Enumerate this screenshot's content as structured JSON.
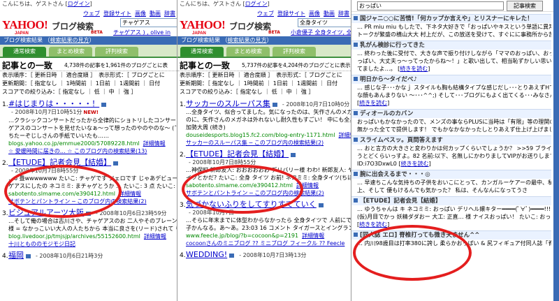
{
  "panel1": {
    "greeting": "こんにちは、ゲストさん",
    "login": "ログイン",
    "nav": [
      "ウェブ",
      "登録サイト",
      "画像",
      "動画",
      "辞書"
    ],
    "logo": "YAHOO! JAPAN",
    "service": "ブログ検索",
    "beta": "BETA",
    "query": "チャゲアス",
    "related": "チャゲアス ) , olive in",
    "bar_title": "ブログ検索結果",
    "bar_link": "検索結果の見方",
    "tabs": [
      "通常検索",
      "まとめ検索",
      "評判検索"
    ],
    "summary_head": "記事との一致",
    "summary_count": "4,738件の記事を1,961件のブログごとに表",
    "opt1": "表示順序：［ 更新日時 ｜ 適合度順 ］　表示形式：［ ブログごとに",
    "opt2": "更新期間：［ 指定なし ｜ 1時間前 ｜ 1日前 ｜ 1週間前 ｜ 日付",
    "opt3": "スコアでの絞り込み：［ 指定なし ｜ 低 ｜ 中 ｜ 強 ］",
    "results": [
      {
        "num": "1.",
        "title": "#はじまりは・・・・・！",
        "date": "- 2008年10月7日10時51分",
        "badge": "NEW!",
        "l1": "…クラシックコンサートだったから全律的にショトリしたコンサートでしたね",
        "l2": "ゲアスのコンサートを見せたいなぁ〜って想ったのやのやのな〜 (ˆ ˆ)",
        "l3": "ちたーぞじしさんの手紙でいいたも……",
        "url": "blogs.yahoo.co.jp/emmue2000/57089228.html",
        "link": "詳細情報",
        "src": "☆ 愛媛時間に届きの… ☆ このブログ内の検索結果(13)"
      },
      {
        "num": "2.",
        "title": "【ETUDE】記者会見【結婚】",
        "date": "- 2008年10月7日8時55分",
        "l1": "…6 畳wwwwwww たいこ: チャゲです ジェロです じゃあデビュー会見が",
        "l2": "ゲアスにしたの ネコミミ: まチャゲとうか … たいこ: 3 点 たいこ: オマエ",
        "url": "sabotento.slmame.com/e390412.html",
        "link": "詳細情報",
        "src": "サボテンとパントライン ─ このブログ内の検索結果(2)"
      },
      {
        "num": "3.",
        "title": "ビジュアルアーツ大阪",
        "date": "- 2008年10月6日23時59分",
        "l1": "…そして俺の場合は古川さや、チャゲアスのお 二人やそのブレーン(",
        "l2": "様 = なかっこいい大人の人たちから 本当に良さを(リード)されて りゅうなの",
        "url": "blog.livedoor.jp/tmjsjp/archives/55152600.html",
        "link": "詳細情報",
        "src": "十川ともののモジモジ日記"
      },
      {
        "num": "4.",
        "title": "福岡",
        "date": "- 2008年10月6日21時3分"
      }
    ]
  },
  "panel2": {
    "nav": [
      "ウェブ",
      "登録サイト",
      "画像",
      "動画",
      "辞書"
    ],
    "logo": "YAHOO! JAPAN",
    "service": "ブログ検索",
    "beta": "BETA",
    "query": "全身タイツ",
    "related": "小倉優子 全身タイツ, 全身",
    "bar_title": "ブログ検索結果",
    "bar_link": "検索結果の見方",
    "tabs": [
      "通常検索",
      "まとめ検索",
      "評判検索"
    ],
    "summary_head": "記事との一致",
    "summary_count": "5,737件の記事を4,204件のブログごとに表示",
    "opt1": "表示順序：［ 更新日時 ｜ 適合度順 ］　表示形式：［ ブログごとに",
    "opt2": "更新期間：［ 指定なし ｜ 1時間前 ｜ 1日前 ｜ 1週間前 ｜ 日付",
    "opt3": "スコアでの絞り込み：［ 指定なし ｜ 低 ｜ 中 ｜ 強 ］",
    "results": [
      {
        "num": "1.",
        "title": "サッカーのスルーパス集",
        "date": "- 2008年10月7日10時0分",
        "l1": "…全身タイツ、似合ってました。気になったのは、矢作さんのメガネ。",
        "l2": "のに、矢作さんのメガネは外れないし耐久性もすごい！ 中にも全身タイツを",
        "l3": "加勢大周 (続き)",
        "url": "douseidesports.blog15.fc2.com/blog-entry-1171.html",
        "link": "詳細情報",
        "src": "サッカーのスルーパス集 ─ このブログ内の検索結果(2)"
      },
      {
        "num": "2.",
        "title": "【ETUDE】記者会見【結婚】",
        "date": "- 2008年10月7日8時55分",
        "l1": "…神保町 新郎友人: おおおおおお デリバリー様 わわ! 新郎友人: ヤ",
        "l2": "イツとかだ? たいこ: 全身 タイツ お前! ネコミミ: 全身タイツ(ちほっ",
        "url": "sabotento.slmame.com/e390412.html",
        "link": "詳細情報",
        "src": "サボテンとパントライン ─ このブログ内の検索結果(2)"
      },
      {
        "num": "3.",
        "title": "気づかないふりをしてすりすてていく",
        "date": "- 2008年10月7日",
        "l1": "…そらに年末までに体型わからなかったら 全身タイツで 人前にでます",
        "l2": "子かんなる。あ〜あ。23:03 16 コメント タイガースとイングランドの 勝利",
        "url": "www.feecle.jp/blog/?b=cocoon&p=2191",
        "link": "詳細情報",
        "src": "cocoonさんのミニブログ ?? ミニブログ フィークル ?? Feecle"
      },
      {
        "num": "4.",
        "title": "WEDDING!",
        "date": "- 2008年10月7日3時13分"
      }
    ]
  },
  "panel3": {
    "query": "おっぱい",
    "button": "記事検索",
    "more": "続きを読む",
    "entries": [
      {
        "title": "国ジャニ○○に苦情!「何カップか言えや」とリスナーにキレた！",
        "lines": [
          "… PR miu miu もしたで、下ネタ大好きで「おっぱいやキスという単語に異常に食いつきすぎる",
          "トークが繁盛の横山大大 村上だが、この放送を受けて、すぐにに事務所から苦"
        ]
      },
      {
        "title": "乳がん検診に行ってきた",
        "lines": [
          "… 終わった後に受付で、大きな声で振り付けしながら「ママのおっぱい、おっぱい、おっぱい",
          "っぱい、大丈夫っ〜ってったからね〜！」と歌い出して、相当恥ずかしい思いをしました",
          "てましたよ…。"
        ]
      },
      {
        "title": "明日から〜タイだべ♪",
        "lines": [
          "… 感じな子･･･かなｊ スタイルも胸も結構タイプな感じだし･･･とりあえずHで見て行きたい",
          "な顔もあんまりない 〜･･･^^;) そして･･･ブログにもよく出てくる･･･みなさんご存知"
        ]
      },
      {
        "title": "ディオールのカバン",
        "lines": [
          "おっぱいもかなかったので、メンズの事ならPLUSに当時は「有限」等の理関のブランドで",
          "無かった全てで提供します！ でもかなかなかったしとりあえず仕上げ上げました。"
        ]
      },
      {
        "title": "スライムべスッ。頁問答えます",
        "lines": [
          "… おと言方の大きさと変わりかは何カップくらいでしょうか？ >>59 ブライドないしね",
          "うとどくらいっすよ。82 名前:以下、名無しにかわりましてVIPがお送りします:",
          "ID:i7O3DxwL0"
        ]
      },
      {
        "title": "腕に出会えるまで・・・◎",
        "lines": [
          "… 早速ちこんな気持ちの子供をおいこにとって、カンガルーケアーの最中、私のおなかの",
          "上、そして 優もけるんでも気かった？ 私は、そんなんになってうさ"
        ]
      },
      {
        "title": "【ETUDE】記者会見【結婚】",
        "lines": [
          "… ゆうちゃんは キ ネコミミ: おっぱい デリヘル嬢キター━━━━(ﾟ∀ﾟ)━━━━!!!",
          "(仮)月目でかっ 妖精ダダおー 大工: 正直… 様 ナイスおっぱい！ たいこ: おっぱい"
        ]
      },
      {
        "title": "[同人誌 エロ] 脊椎打っても微き夭ません^^",
        "lines": [
          "… 内川98歳目は打率380に誇し 柔らかおっぱい & 尻フィギュア付同人誌「脊"
        ]
      }
    ]
  }
}
